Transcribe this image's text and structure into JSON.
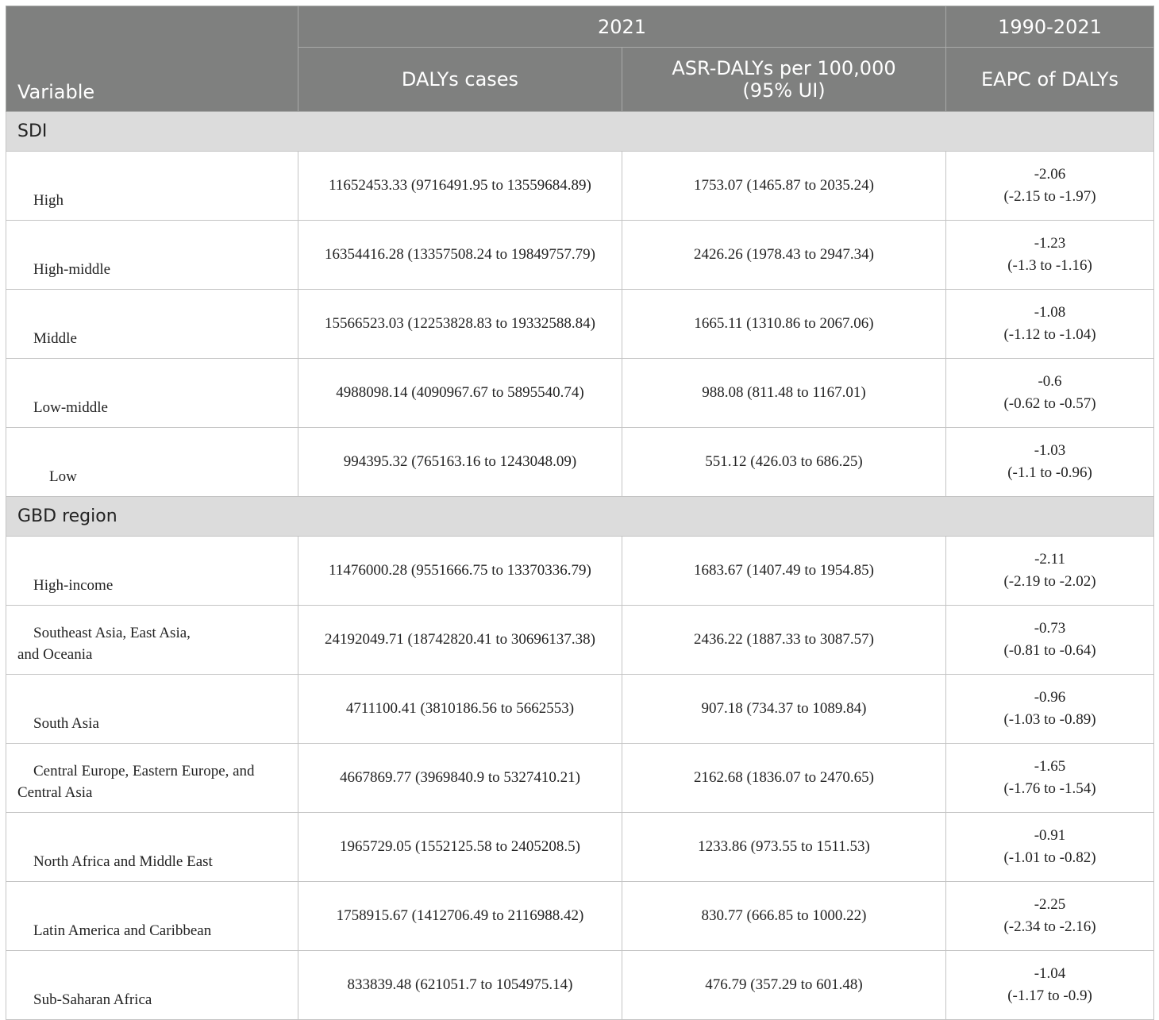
{
  "header": {
    "variable": "Variable",
    "group_2021": "2021",
    "group_trend": "1990-2021",
    "col_cases": "DALYs cases",
    "col_asr_line1": "ASR-DALYs per 100,000",
    "col_asr_line2": "(95% UI)",
    "col_eapc": "EAPC of DALYs"
  },
  "sections": [
    {
      "title": "SDI",
      "rows": [
        {
          "label_line1": "High",
          "label_line2": "",
          "cases": "11652453.33 (9716491.95 to 13559684.89)",
          "asr": "1753.07 (1465.87 to 2035.24)",
          "eapc": "-2.06",
          "eapc_ci": "(-2.15 to -1.97)"
        },
        {
          "label_line1": "High-middle",
          "label_line2": "",
          "cases": "16354416.28 (13357508.24 to 19849757.79)",
          "asr": "2426.26 (1978.43 to 2947.34)",
          "eapc": "-1.23",
          "eapc_ci": "(-1.3 to -1.16)"
        },
        {
          "label_line1": "Middle",
          "label_line2": "",
          "cases": "15566523.03 (12253828.83 to 19332588.84)",
          "asr": "1665.11 (1310.86 to 2067.06)",
          "eapc": "-1.08",
          "eapc_ci": "(-1.12 to -1.04)"
        },
        {
          "label_line1": "Low-middle",
          "label_line2": "",
          "cases": "4988098.14 (4090967.67 to 5895540.74)",
          "asr": "988.08 (811.48 to 1167.01)",
          "eapc": "-0.6",
          "eapc_ci": "(-0.62 to -0.57)"
        },
        {
          "label_line1": "Low",
          "label_line2": "",
          "cases": "994395.32 (765163.16 to 1243048.09)",
          "asr": "551.12 (426.03 to 686.25)",
          "eapc": "-1.03",
          "eapc_ci": "(-1.1 to -0.96)"
        }
      ]
    },
    {
      "title": "GBD region",
      "rows": [
        {
          "label_line1": "High-income",
          "label_line2": "",
          "cases": "11476000.28 (9551666.75 to 13370336.79)",
          "asr": "1683.67 (1407.49 to 1954.85)",
          "eapc": "-2.11",
          "eapc_ci": "(-2.19 to -2.02)"
        },
        {
          "label_line1": "Southeast Asia, East Asia,",
          "label_line2": "and Oceania",
          "cases": "24192049.71 (18742820.41 to 30696137.38)",
          "asr": "2436.22 (1887.33 to 3087.57)",
          "eapc": "-0.73",
          "eapc_ci": "(-0.81 to -0.64)"
        },
        {
          "label_line1": "South Asia",
          "label_line2": "",
          "cases": "4711100.41 (3810186.56 to 5662553)",
          "asr": "907.18 (734.37 to 1089.84)",
          "eapc": "-0.96",
          "eapc_ci": "(-1.03 to -0.89)"
        },
        {
          "label_line1": "Central Europe, Eastern Europe, and",
          "label_line2": "Central Asia",
          "cases": "4667869.77 (3969840.9 to 5327410.21)",
          "asr": "2162.68 (1836.07 to 2470.65)",
          "eapc": "-1.65",
          "eapc_ci": "(-1.76 to -1.54)"
        },
        {
          "label_line1": "North Africa and Middle East",
          "label_line2": "",
          "cases": "1965729.05 (1552125.58 to 2405208.5)",
          "asr": "1233.86 (973.55 to 1511.53)",
          "eapc": "-0.91",
          "eapc_ci": "(-1.01 to -0.82)"
        },
        {
          "label_line1": "Latin America and Caribbean",
          "label_line2": "",
          "cases": "1758915.67 (1412706.49 to 2116988.42)",
          "asr": "830.77 (666.85 to 1000.22)",
          "eapc": "-2.25",
          "eapc_ci": "(-2.34 to -2.16)"
        },
        {
          "label_line1": "Sub-Saharan Africa",
          "label_line2": "",
          "cases": "833839.48 (621051.7 to 1054975.14)",
          "asr": "476.79 (357.29 to 601.48)",
          "eapc": "-1.04",
          "eapc_ci": "(-1.17 to -0.9)"
        }
      ]
    }
  ]
}
